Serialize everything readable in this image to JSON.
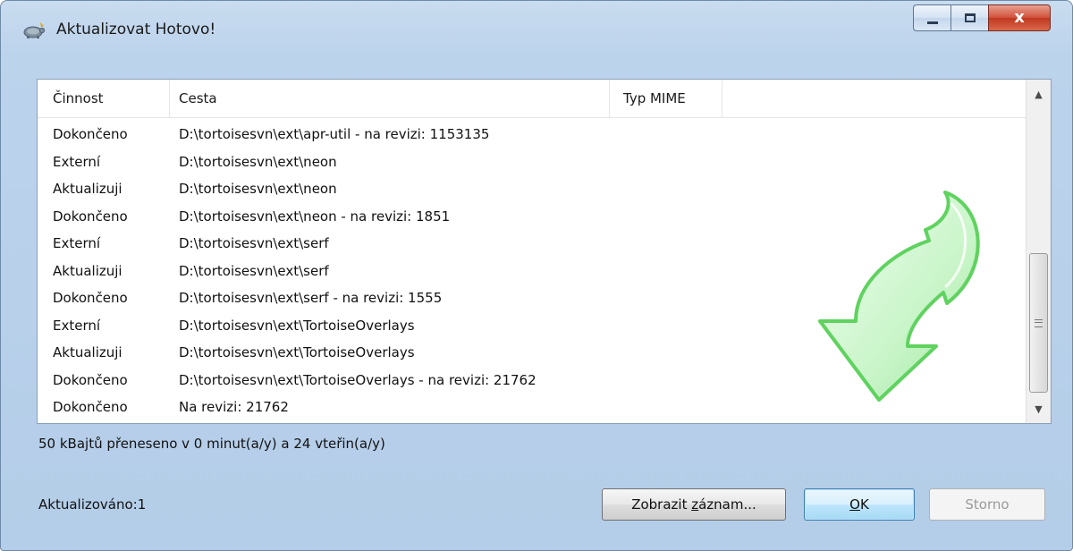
{
  "window": {
    "title": "Aktualizovat Hotovo!",
    "close_glyph": "x"
  },
  "list": {
    "columns": [
      "Činnost",
      "Cesta",
      "Typ MIME"
    ],
    "rows": [
      {
        "action": "Dokončeno",
        "path": "D:\\tortoisesvn\\ext\\apr-util - na revizi: 1153135"
      },
      {
        "action": "Externí",
        "path": "D:\\tortoisesvn\\ext\\neon"
      },
      {
        "action": "Aktualizuji",
        "path": "D:\\tortoisesvn\\ext\\neon"
      },
      {
        "action": "Dokončeno",
        "path": "D:\\tortoisesvn\\ext\\neon - na revizi: 1851"
      },
      {
        "action": "Externí",
        "path": "D:\\tortoisesvn\\ext\\serf"
      },
      {
        "action": "Aktualizuji",
        "path": "D:\\tortoisesvn\\ext\\serf"
      },
      {
        "action": "Dokončeno",
        "path": "D:\\tortoisesvn\\ext\\serf - na revizi: 1555"
      },
      {
        "action": "Externí",
        "path": "D:\\tortoisesvn\\ext\\TortoiseOverlays"
      },
      {
        "action": "Aktualizuji",
        "path": "D:\\tortoisesvn\\ext\\TortoiseOverlays"
      },
      {
        "action": "Dokončeno",
        "path": "D:\\tortoisesvn\\ext\\TortoiseOverlays - na revizi: 21762"
      },
      {
        "action": "Dokončeno",
        "path": "Na revizi: 21762"
      }
    ]
  },
  "status": {
    "transfer": "50 kBajtů přeneseno v 0 minut(a/y) a 24 vteřin(a/y)",
    "updated": "Aktualizováno:1"
  },
  "buttons": {
    "show_log_prefix": "Zobrazit ",
    "show_log_accel": "z",
    "show_log_suffix": "áznam...",
    "ok_accel": "O",
    "ok_suffix": "K",
    "cancel": "Storno"
  },
  "colors": {
    "arrow_fill": "#c9f5c9",
    "arrow_stroke": "#5fd25f",
    "title_bar": "#bcd3ec",
    "close_button": "#c9462e"
  },
  "icons": {
    "app": "tortoise-icon",
    "arrow": "update-arrow-icon"
  }
}
